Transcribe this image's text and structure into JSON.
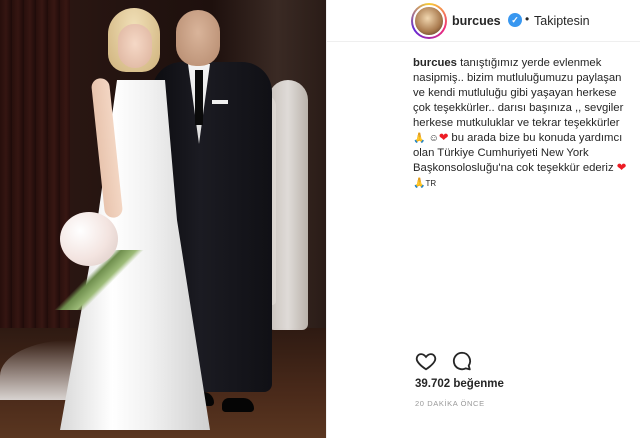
{
  "post": {
    "username": "burcues",
    "verified_icon": "verified-badge-icon",
    "separator": "•",
    "follow_status": "Takiptesin",
    "caption": {
      "line1": "tanıştığımız yerde evlenmek",
      "line2": "nasipmiş.. bizim mutluluğumuzu paylaşan",
      "line3": "ve kendi mutluluğu gibi yaşayan herkese",
      "line4": "çok teşekkürler.. darısı başınıza ,, sevgiler",
      "line5": "herkese mutkuluklar ve tekrar teşekkürler",
      "line6": "bu arada bize bu konuda yardımcı",
      "line7": "olan Türkiye Cumhuriyeti New York",
      "line8": "Başkonsolosluğu'na cok teşekkür ederiz",
      "line9": "TR"
    },
    "like_icon": "heart-icon",
    "comment_icon": "comment-icon",
    "likes": "39.702 beğenme",
    "timestamp": "20 DAKİKA ÖNCE"
  },
  "colors": {
    "verified": "#3897f0",
    "heart": "#ed1c24",
    "text": "#262626",
    "muted": "#999999"
  }
}
